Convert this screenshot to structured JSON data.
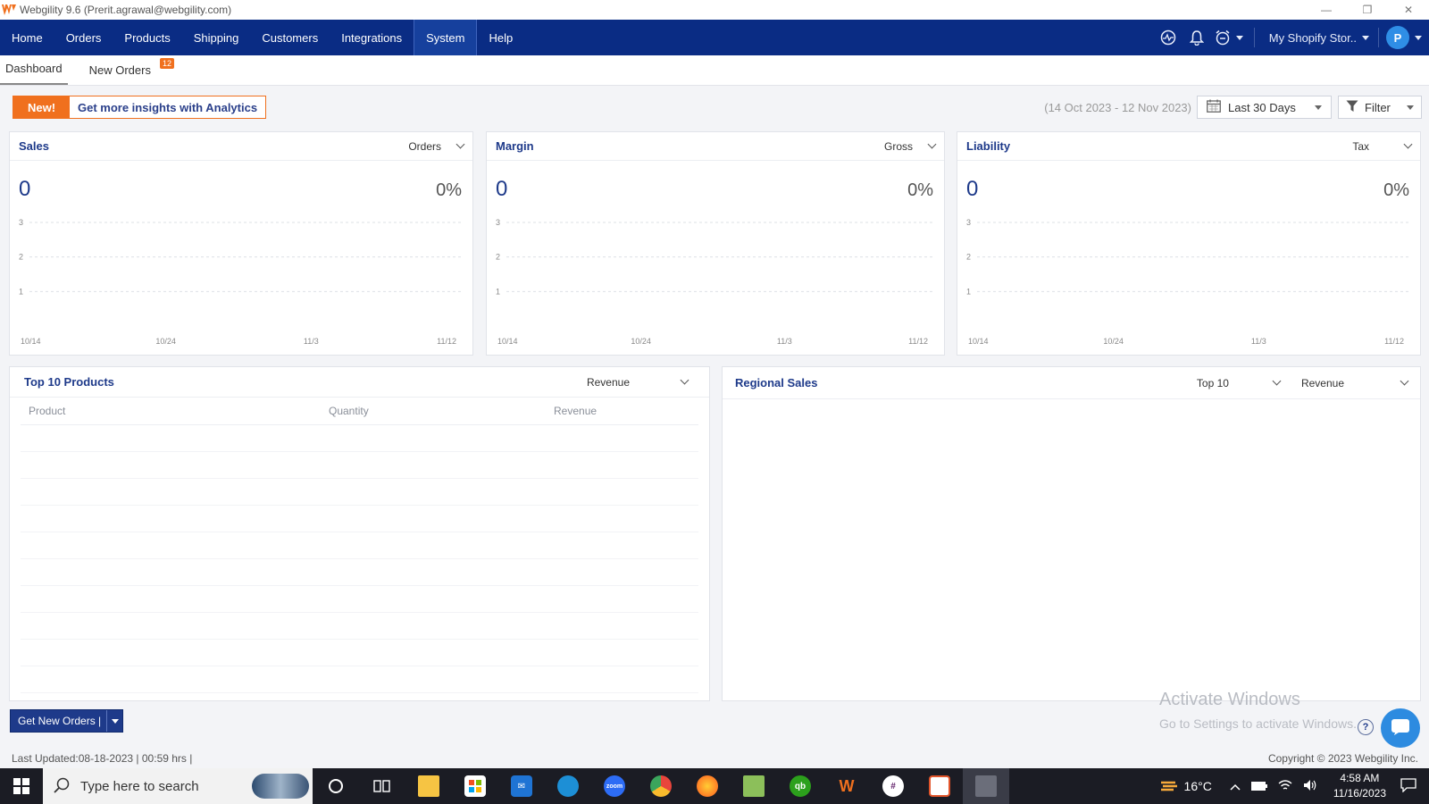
{
  "window": {
    "title": "Webgility 9.6 (Prerit.agrawal@webgility.com)",
    "logo_icon": "webgility-logo-icon",
    "controls": [
      "minimize",
      "restore",
      "close"
    ]
  },
  "nav": {
    "items": [
      {
        "label": "Home"
      },
      {
        "label": "Orders"
      },
      {
        "label": "Products"
      },
      {
        "label": "Shipping"
      },
      {
        "label": "Customers"
      },
      {
        "label": "Integrations"
      },
      {
        "label": "System"
      },
      {
        "label": "Help"
      }
    ],
    "active": "System",
    "store_label": "My Shopify Stor..",
    "avatar_letter": "P",
    "accent": "#0a2c84"
  },
  "subtabs": {
    "dashboard": "Dashboard",
    "new_orders": "New Orders",
    "new_orders_count": "12"
  },
  "toolbar": {
    "new_label": "New!",
    "analytics_msg": "Get more insights with Analytics",
    "date_range": "(14 Oct 2023 - 12 Nov 2023)",
    "period_label": "Last 30 Days",
    "filter_label": "Filter"
  },
  "cards": {
    "sales": {
      "title": "Sales",
      "selector": "Orders",
      "value": "0",
      "pct": "0%"
    },
    "margin": {
      "title": "Margin",
      "selector": "Gross",
      "value": "0",
      "pct": "0%"
    },
    "liability": {
      "title": "Liability",
      "selector": "Tax",
      "value": "0",
      "pct": "0%"
    }
  },
  "chart_data": [
    {
      "type": "line",
      "x": [
        "10/14",
        "10/24",
        "11/3",
        "11/12"
      ],
      "yticks": [
        1,
        2,
        3
      ],
      "ylim": [
        0,
        3
      ],
      "series": [],
      "grid": true
    },
    {
      "type": "line",
      "x": [
        "10/14",
        "10/24",
        "11/3",
        "11/12"
      ],
      "yticks": [
        1,
        2,
        3
      ],
      "ylim": [
        0,
        3
      ],
      "series": [],
      "grid": true
    },
    {
      "type": "line",
      "x": [
        "10/14",
        "10/24",
        "11/3",
        "11/12"
      ],
      "yticks": [
        1,
        2,
        3
      ],
      "ylim": [
        0,
        3
      ],
      "series": [],
      "grid": true
    }
  ],
  "top_products": {
    "title": "Top 10 Products",
    "selector": "Revenue",
    "columns": [
      "Product",
      "Quantity",
      "Revenue"
    ],
    "rows": []
  },
  "regional": {
    "title": "Regional Sales",
    "selector_count": "Top 10",
    "selector_metric": "Revenue"
  },
  "footer": {
    "get_orders": "Get New Orders |",
    "last_updated": "Last Updated:08-18-2023 | 00:59 hrs |",
    "copyright": "Copyright © 2023 Webgility Inc.",
    "watermark_title": "Activate Windows",
    "watermark_sub": "Go to Settings to activate Windows."
  },
  "taskbar": {
    "search_placeholder": "Type here to search",
    "temperature": "16°C",
    "time": "4:58 AM",
    "date": "11/16/2023"
  }
}
